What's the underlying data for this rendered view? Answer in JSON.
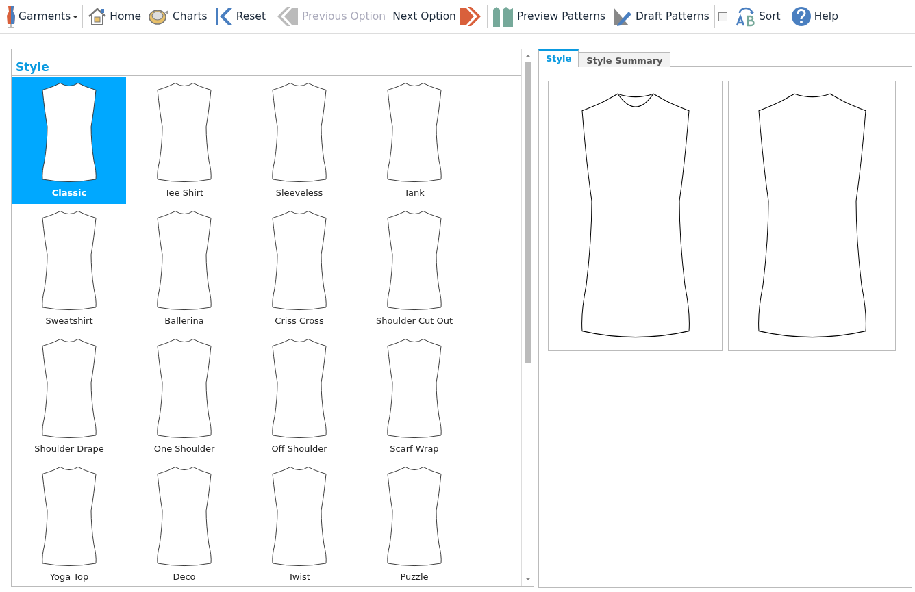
{
  "toolbar_groups": [
    [
      {
        "kind": "menu",
        "label": "Garments",
        "disabled": false
      }
    ],
    [
      {
        "kind": "button",
        "label": "Home",
        "disabled": false
      },
      {
        "kind": "button",
        "label": "Charts",
        "disabled": false
      },
      {
        "kind": "button",
        "label": "Reset",
        "disabled": false
      }
    ],
    [
      {
        "kind": "button",
        "label": "Previous Option",
        "disabled": true
      },
      {
        "kind": "button-after",
        "label": "Next Option",
        "disabled": false
      }
    ],
    [
      {
        "kind": "button",
        "label": "Preview Patterns",
        "disabled": false
      },
      {
        "kind": "button",
        "label": "Draft Patterns",
        "disabled": false
      }
    ],
    [
      {
        "kind": "checkbox",
        "label": "Sort",
        "checked": false
      }
    ],
    [
      {
        "kind": "button",
        "label": "Help",
        "disabled": false
      }
    ]
  ],
  "style_panel": {
    "title": "Style",
    "styles": [
      {
        "label": "Classic",
        "selected": true
      },
      {
        "label": "Tee Shirt",
        "selected": false
      },
      {
        "label": "Sleeveless",
        "selected": false
      },
      {
        "label": "Tank",
        "selected": false
      },
      {
        "label": "Sweatshirt",
        "selected": false
      },
      {
        "label": "Ballerina",
        "selected": false
      },
      {
        "label": "Criss Cross",
        "selected": false
      },
      {
        "label": "Shoulder Cut Out",
        "selected": false
      },
      {
        "label": "Shoulder Drape",
        "selected": false
      },
      {
        "label": "One Shoulder",
        "selected": false
      },
      {
        "label": "Off Shoulder",
        "selected": false
      },
      {
        "label": "Scarf Wrap",
        "selected": false
      },
      {
        "label": "Yoga Top",
        "selected": false
      },
      {
        "label": "Deco",
        "selected": false
      },
      {
        "label": "Twist",
        "selected": false
      },
      {
        "label": "Puzzle",
        "selected": false
      }
    ]
  },
  "preview_panel": {
    "tabs": [
      {
        "label": "Style",
        "selected": true
      },
      {
        "label": "Style Summary",
        "selected": false
      }
    ]
  }
}
